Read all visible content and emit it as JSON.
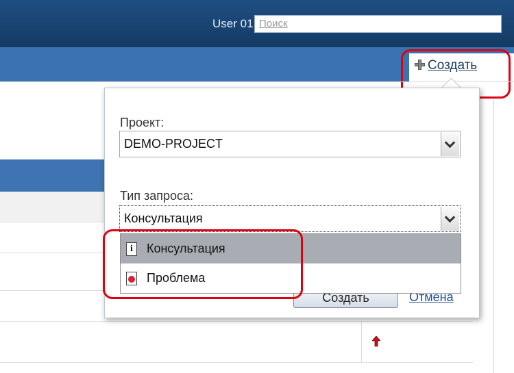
{
  "header": {
    "user_name": "User 01",
    "user_separator": "|",
    "search_placeholder": "Поиск"
  },
  "toolbar": {
    "create_label": "Создать"
  },
  "dialog": {
    "project_label": "Проект:",
    "project_value": "DEMO-PROJECT",
    "request_type_label": "Тип запроса:",
    "request_type_value": "Консультация",
    "options": [
      {
        "label": "Консультация",
        "icon": "info-icon"
      },
      {
        "label": "Проблема",
        "icon": "bug-icon"
      }
    ],
    "create_button": "Создать",
    "cancel_link": "Отмена"
  },
  "colors": {
    "topbar": "#1a4472",
    "bluebar": "#3b73b0",
    "highlight_ring": "#e0000e",
    "selected_option": "#a9adb3"
  }
}
